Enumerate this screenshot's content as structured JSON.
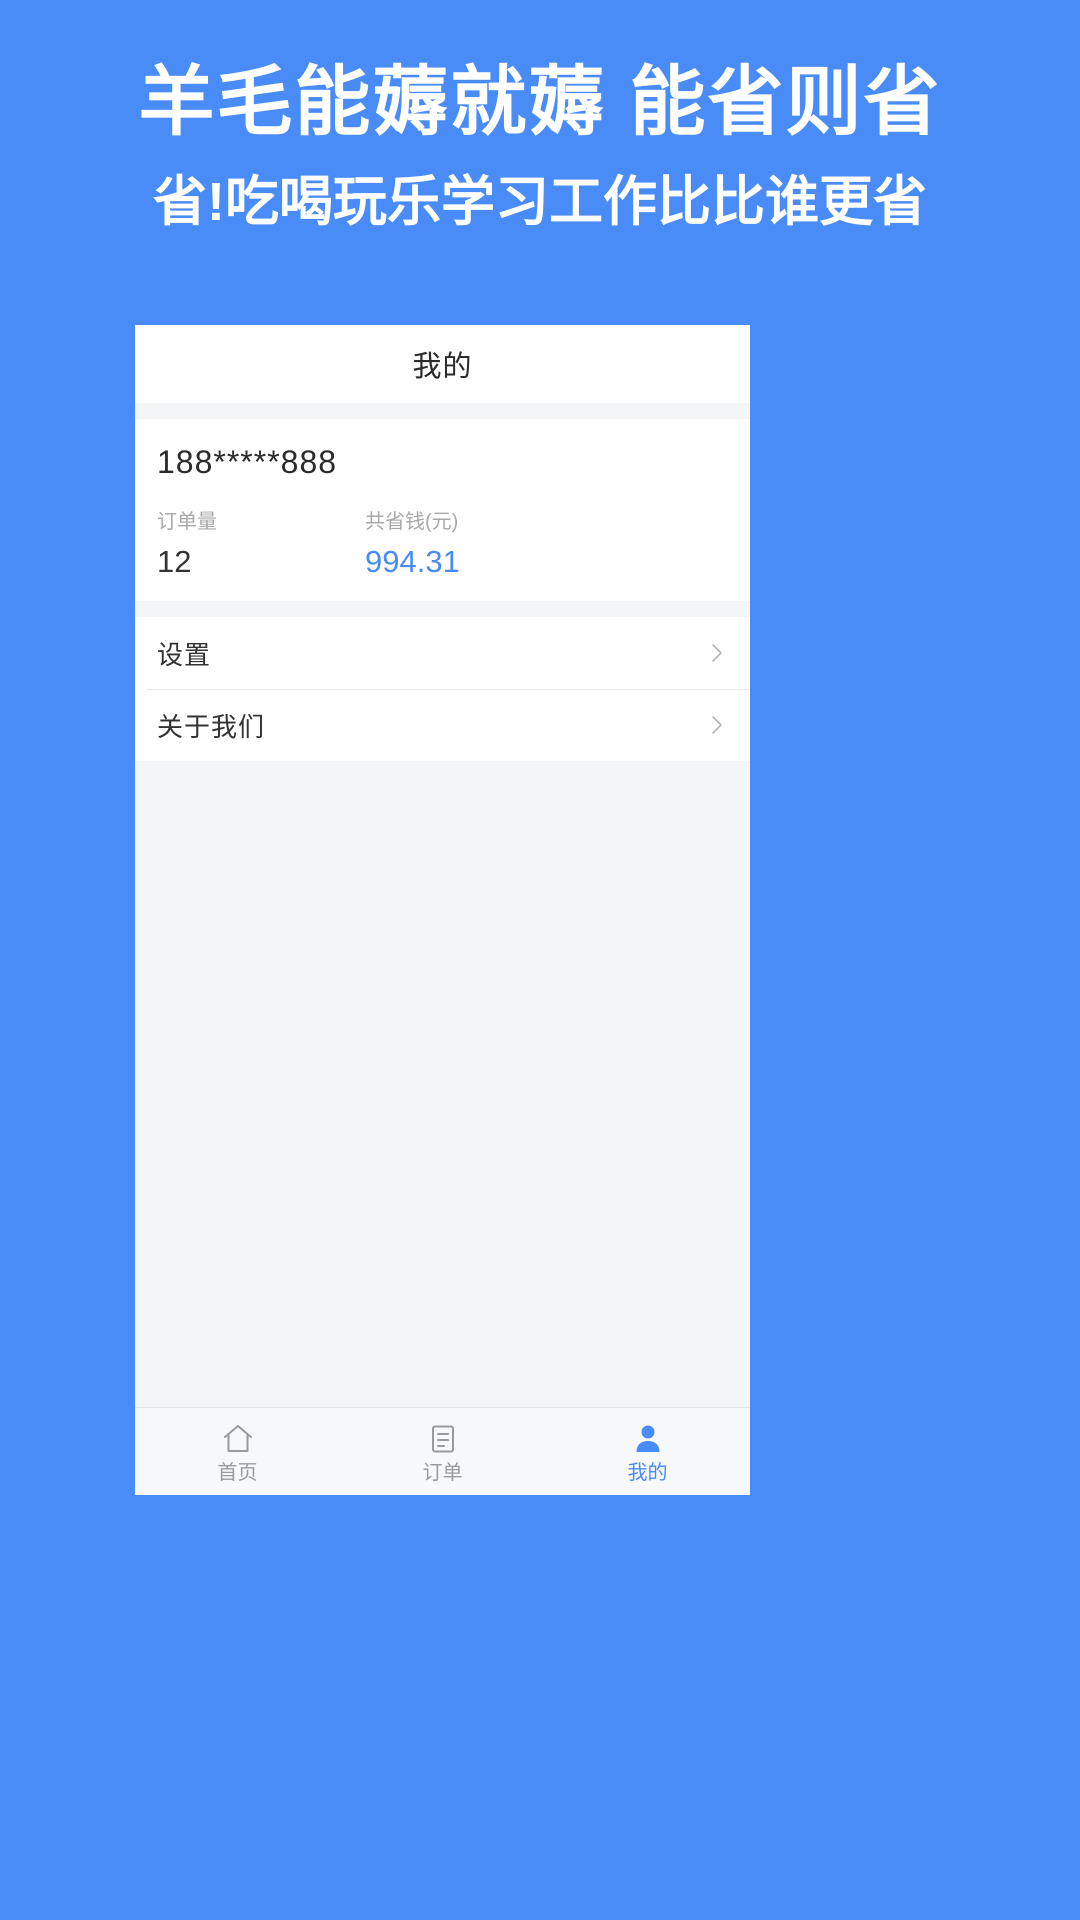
{
  "promo": {
    "title": "羊毛能薅就薅 能省则省",
    "subtitle": "省!吃喝玩乐学习工作比比谁更省",
    "background_color": "#4a8cf7",
    "text_color": "#ffffff"
  },
  "app": {
    "navbar": {
      "title": "我的"
    },
    "profile": {
      "phone_number": "188*****888",
      "stats": [
        {
          "label": "订单量",
          "value": "12",
          "color": "#333333"
        },
        {
          "label": "共省钱(元)",
          "value": "994.31",
          "color": "#4a8cf7"
        }
      ]
    },
    "menu": [
      {
        "label": "设置",
        "icon": "chevron-right-icon"
      },
      {
        "label": "关于我们",
        "icon": "chevron-right-icon"
      }
    ],
    "tabbar": {
      "tabs": [
        {
          "label": "首页",
          "icon": "home-icon",
          "active": false
        },
        {
          "label": "订单",
          "icon": "order-list-icon",
          "active": false
        },
        {
          "label": "我的",
          "icon": "person-icon",
          "active": true
        }
      ],
      "active_color": "#4a8cf7",
      "inactive_color": "#9a9a9a"
    }
  }
}
